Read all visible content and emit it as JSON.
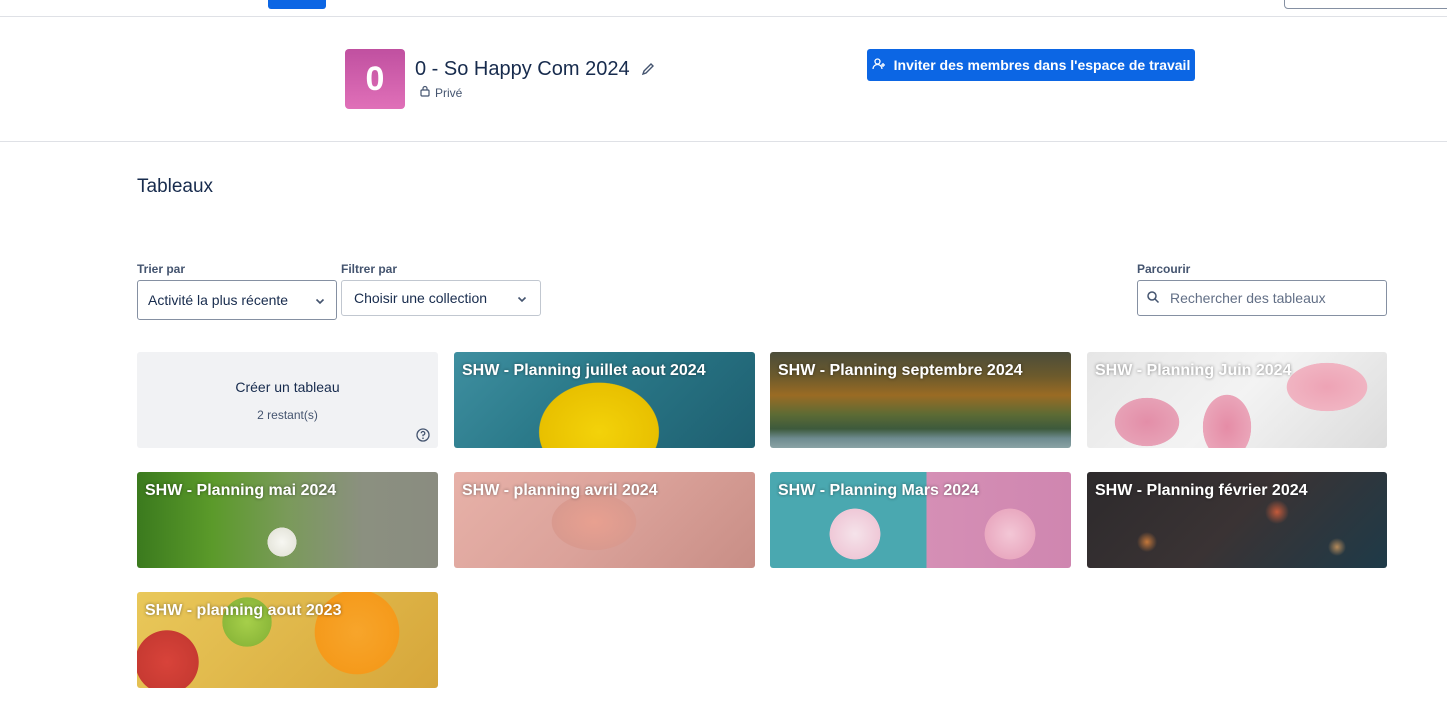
{
  "workspace": {
    "avatar_letter": "0",
    "name": "0 - So Happy Com 2024",
    "privacy": "Privé",
    "invite_label": "Inviter des membres dans l'espace de travail"
  },
  "boards_section": {
    "title": "Tableaux",
    "sort": {
      "label": "Trier par",
      "value": "Activité la plus récente"
    },
    "filter": {
      "label": "Filtrer par",
      "value": "Choisir une collection"
    },
    "browse": {
      "label": "Parcourir",
      "placeholder": "Rechercher des tableaux"
    },
    "create": {
      "title": "Créer un tableau",
      "remaining": "2 restant(s)"
    },
    "boards": [
      {
        "title": "SHW - Planning juillet aout 2024"
      },
      {
        "title": "SHW - Planning septembre 2024"
      },
      {
        "title": "SHW - Planning Juin 2024"
      },
      {
        "title": "SHW - Planning mai 2024"
      },
      {
        "title": "SHW - planning avril 2024"
      },
      {
        "title": "SHW - Planning Mars 2024"
      },
      {
        "title": "SHW - Planning février 2024"
      },
      {
        "title": "SHW - planning aout 2023"
      }
    ]
  },
  "colors": {
    "primary": "#0c66e4",
    "avatar": "#d060ad",
    "text": "#172b4d",
    "create_tile_bg": "#f1f2f4"
  },
  "icons": {
    "edit": "pencil-icon",
    "privacy": "lock-icon",
    "invite": "add-user-icon",
    "dropdown": "chevron-down-icon",
    "search": "search-icon",
    "help": "help-icon"
  }
}
